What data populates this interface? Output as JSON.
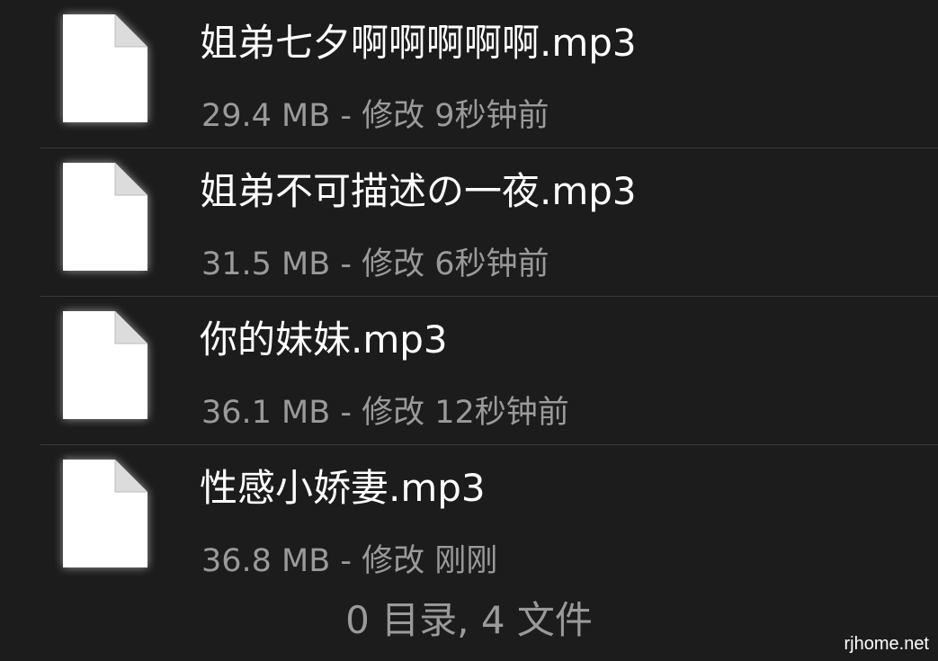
{
  "files": [
    {
      "name": "姐弟七夕啊啊啊啊啊.mp3",
      "meta": "29.4 MB - 修改 9秒钟前",
      "icon": "document-icon"
    },
    {
      "name": "姐弟不可描述の一夜.mp3",
      "meta": "31.5 MB - 修改 6秒钟前",
      "icon": "document-icon"
    },
    {
      "name": "你的妹妹.mp3",
      "meta": "36.1 MB - 修改 12秒钟前",
      "icon": "document-icon"
    },
    {
      "name": "性感小娇妻.mp3",
      "meta": "36.8 MB - 修改 刚刚",
      "icon": "document-icon"
    }
  ],
  "summary": "0 目录, 4 文件",
  "watermark": "rjhome.net",
  "colors": {
    "background": "#1c1c1c",
    "primary_text": "#ffffff",
    "secondary_text": "#9a9a9a",
    "divider": "#3a3a3a"
  }
}
